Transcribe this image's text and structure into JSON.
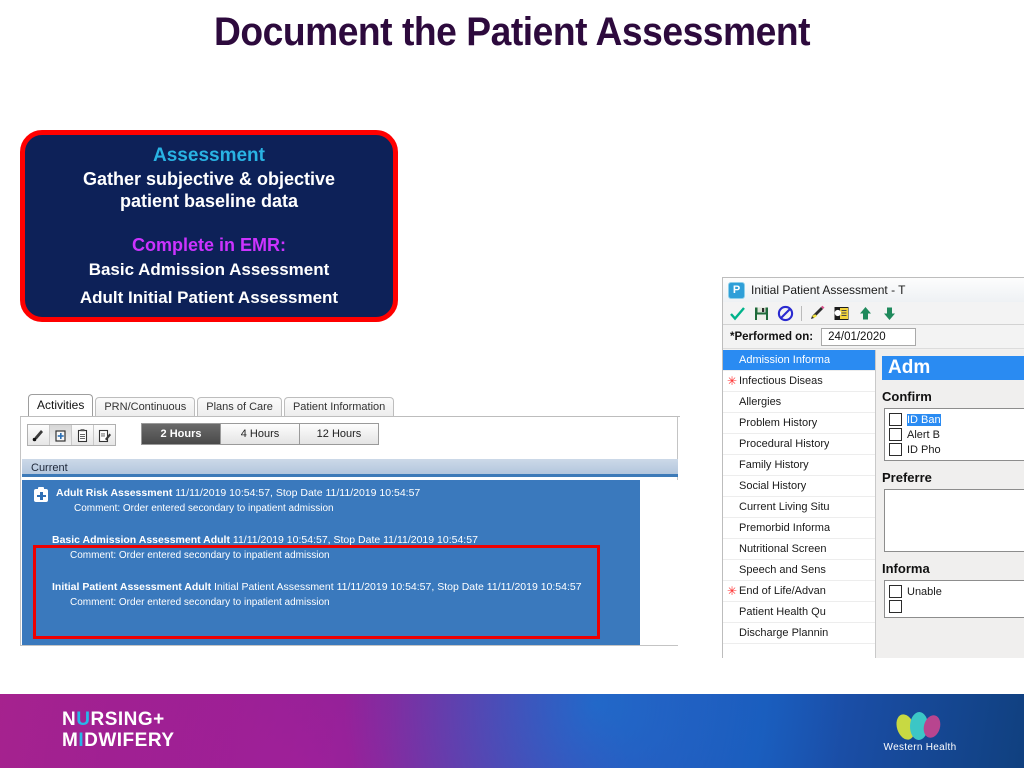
{
  "slide": {
    "title": "Document the Patient Assessment"
  },
  "callout": {
    "heading": "Assessment",
    "line1": "Gather subjective & objective",
    "line2": "patient baseline data",
    "subheading": "Complete in EMR:",
    "item1": "Basic Admission Assessment",
    "item2": "Adult Initial Patient Assessment",
    "colors": {
      "background": "#0d2158",
      "border": "#ff0000",
      "heading": "#29b3e3",
      "subheading": "#cc33ff",
      "body": "#ffffff"
    }
  },
  "activities_window": {
    "tabs": [
      {
        "label": "Activities",
        "active": true
      },
      {
        "label": "PRN/Continuous",
        "active": false
      },
      {
        "label": "Plans of Care",
        "active": false
      },
      {
        "label": "Patient Information",
        "active": false
      }
    ],
    "toolbar_icons": [
      {
        "name": "pen-icon",
        "pressed": false
      },
      {
        "name": "add-box-icon",
        "pressed": true
      },
      {
        "name": "clipboard-icon",
        "pressed": false
      },
      {
        "name": "clipboard-edit-icon",
        "pressed": false
      }
    ],
    "time_range": {
      "options": [
        "2 Hours",
        "4 Hours",
        "12 Hours"
      ],
      "selected": "2 Hours"
    },
    "group_header": "Current",
    "rows": [
      {
        "icon": "medkit-icon",
        "title": "Adult Risk Assessment",
        "detail": "11/11/2019 10:54:57, Stop Date 11/11/2019 10:54:57",
        "comment": "Comment: Order entered secondary to inpatient admission",
        "highlighted": false
      },
      {
        "icon": "",
        "title": "Basic Admission Assessment Adult",
        "detail": "11/11/2019 10:54:57, Stop Date 11/11/2019 10:54:57",
        "comment": "Comment: Order entered secondary to inpatient admission",
        "highlighted": true
      },
      {
        "icon": "",
        "title": "Initial Patient Assessment Adult",
        "detail": "Initial Patient Assessment 11/11/2019 10:54:57, Stop Date 11/11/2019 10:54:57",
        "comment": "Comment: Order entered secondary to inpatient admission",
        "highlighted": true
      }
    ]
  },
  "assessment_window": {
    "title": "Initial Patient Assessment - T",
    "app_icon_letter": "P",
    "toolbar_icons": [
      "check-icon",
      "save-icon",
      "cancel-icon",
      "separator",
      "pen-icon",
      "note-icon",
      "arrow-up-icon",
      "arrow-down-icon"
    ],
    "performed_on": {
      "label": "*Performed on:",
      "value": "24/01/2020"
    },
    "sections": [
      {
        "label": "Admission Informa",
        "selected": true,
        "required": false
      },
      {
        "label": "Infectious Diseas",
        "selected": false,
        "required": true
      },
      {
        "label": "Allergies",
        "selected": false,
        "required": false
      },
      {
        "label": "Problem History",
        "selected": false,
        "required": false
      },
      {
        "label": "Procedural History",
        "selected": false,
        "required": false
      },
      {
        "label": "Family History",
        "selected": false,
        "required": false
      },
      {
        "label": "Social History",
        "selected": false,
        "required": false
      },
      {
        "label": "Current Living Situ",
        "selected": false,
        "required": false
      },
      {
        "label": "Premorbid Informa",
        "selected": false,
        "required": false
      },
      {
        "label": "Nutritional Screen",
        "selected": false,
        "required": false
      },
      {
        "label": "Speech and Sens",
        "selected": false,
        "required": false
      },
      {
        "label": "End of Life/Advan",
        "selected": false,
        "required": true
      },
      {
        "label": "Patient Health Qu",
        "selected": false,
        "required": false
      },
      {
        "label": "Discharge Plannin",
        "selected": false,
        "required": false
      }
    ],
    "form": {
      "header": "Adm",
      "group1_label": "Confirm",
      "group1_items": [
        {
          "label": "ID Ban",
          "highlighted": true
        },
        {
          "label": "Alert B",
          "highlighted": false
        },
        {
          "label": "ID Pho",
          "highlighted": false
        }
      ],
      "group2_label": "Preferre",
      "group3_label": "Informa",
      "group3_items": [
        {
          "label": "Unable",
          "highlighted": false
        }
      ]
    }
  },
  "footer": {
    "brand_line1_pre": "N",
    "brand_line1_u": "U",
    "brand_line1_post": "RSING+",
    "brand_line2_pre": "M",
    "brand_line2_i": "I",
    "brand_line2_post": "DWIFERY",
    "org_name": "Western Health"
  }
}
